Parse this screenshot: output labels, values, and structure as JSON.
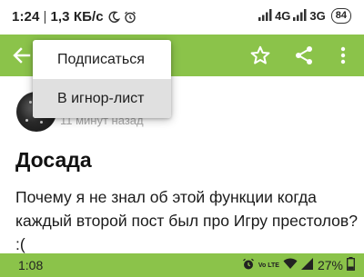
{
  "status_bar": {
    "time": "1:24",
    "speed": "1,3 КБ/с",
    "network1": "4G",
    "network2": "3G",
    "battery": "84",
    "icons": [
      "moon-icon",
      "alarm-icon",
      "signal-icon",
      "signal-icon"
    ]
  },
  "app_bar": {
    "color": "#8bc34a",
    "icons": [
      "back-arrow-icon",
      "star-icon",
      "share-icon",
      "more-vert-icon"
    ]
  },
  "menu": {
    "items": [
      {
        "label": "Подписаться"
      },
      {
        "label": "В игнор-лист",
        "highlighted": true
      }
    ]
  },
  "post": {
    "time_ago": "11 минут назад",
    "title": "Досада",
    "body": "Почему я не знал об этой функции когда каждый второй пост был про Игру престолов? :("
  },
  "bottom_bar": {
    "time": "1:08",
    "volte": "Vo LTE",
    "battery_percent": "27%",
    "icons": [
      "alarm-icon",
      "volte-icon",
      "wifi-icon",
      "signal-icon",
      "battery-icon"
    ]
  }
}
